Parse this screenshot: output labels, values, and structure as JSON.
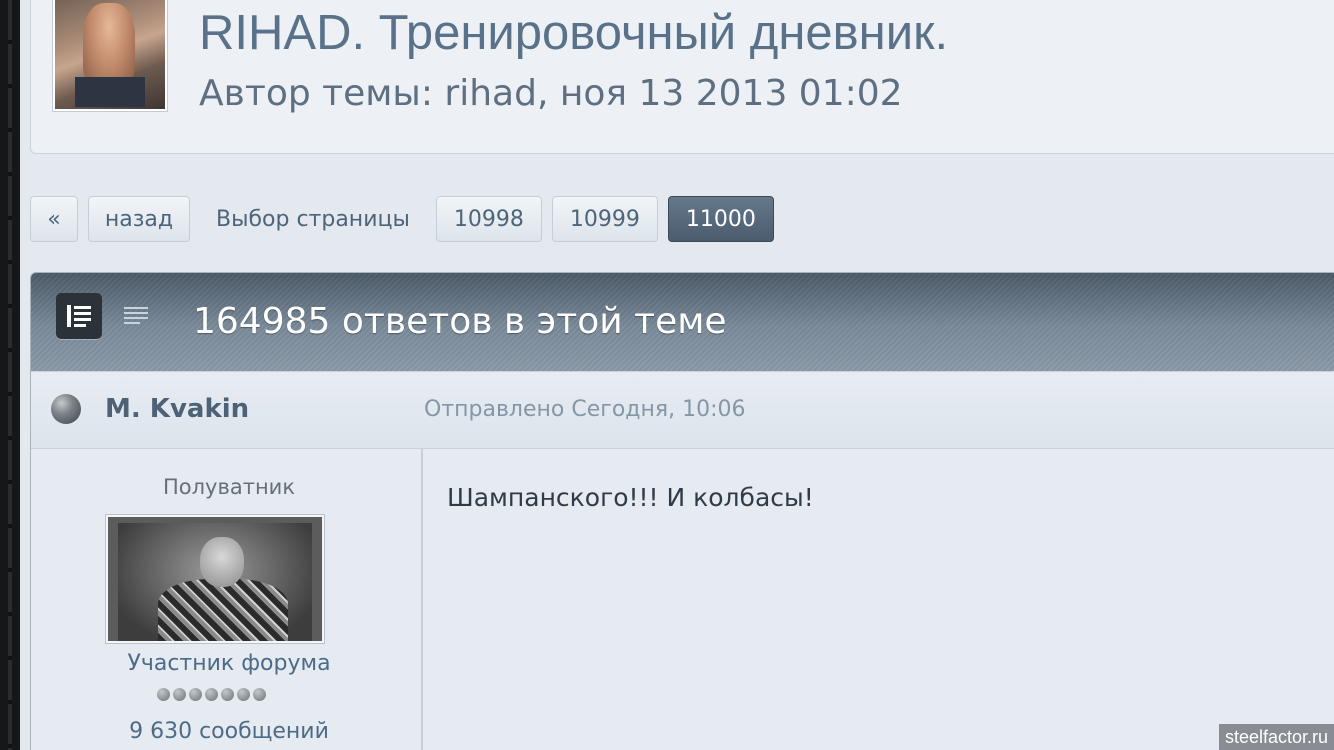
{
  "topic": {
    "title": "RIHAD. Тренировочный дневник.",
    "meta": "Автор темы: rihad, ноя 13 2013 01:02"
  },
  "pagination": {
    "first_label": "«",
    "back_label": "назад",
    "select_label": "Выбор страницы",
    "pages": [
      "10998",
      "10999",
      "11000"
    ],
    "active_page": "11000"
  },
  "posts": {
    "header_title": "164985 ответов в этой теме",
    "view_icons": [
      "full-view-icon",
      "compact-view-icon"
    ]
  },
  "post": {
    "author": "M. Kvakin",
    "date": "Отправлено Сегодня, 10:06",
    "author_title": "Полуватник",
    "author_group": "Участник форума",
    "pips": 7,
    "post_count": "9 630 сообщений",
    "content": "Шампанского!!! И колбасы!"
  },
  "watermark": "steelfactor.ru",
  "colors": {
    "accent": "#5a7289",
    "active_page_bg": "#4a5c6e",
    "header_bar": "#5d6c7a"
  }
}
